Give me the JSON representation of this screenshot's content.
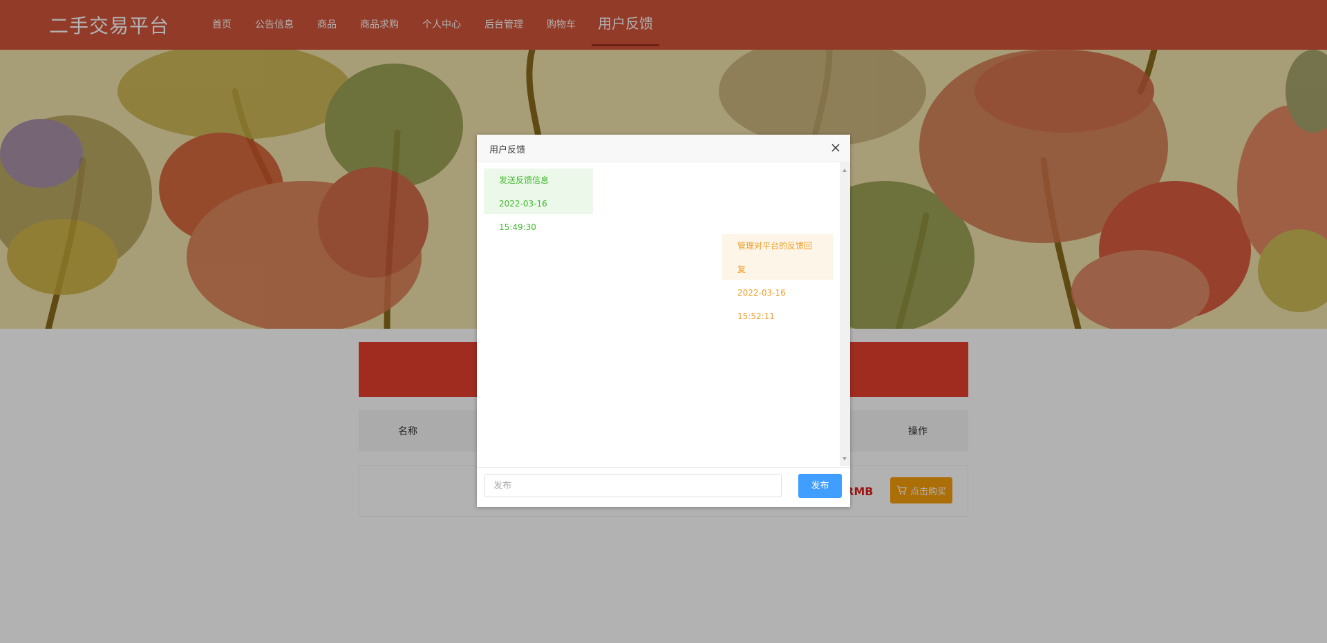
{
  "header": {
    "brand": "二手交易平台",
    "nav": [
      {
        "label": "首页"
      },
      {
        "label": "公告信息"
      },
      {
        "label": "商品"
      },
      {
        "label": "商品求购"
      },
      {
        "label": "个人中心"
      },
      {
        "label": "后台管理"
      },
      {
        "label": "购物车"
      },
      {
        "label": "用户反馈"
      }
    ],
    "active_index": 7
  },
  "table": {
    "col_name": "名称",
    "col_action": "操作",
    "row": {
      "price_unit": "RMB",
      "buy_label": "点击购买"
    }
  },
  "dialog": {
    "title": "用户反馈",
    "messages": [
      {
        "from": "user",
        "text": "发送反馈信息",
        "time": "2022-03-16 15:49:30"
      },
      {
        "from": "admin",
        "text": "管理对平台的反馈回复",
        "time": "2022-03-16 15:52:11"
      }
    ],
    "input_placeholder": "发布",
    "send_label": "发布"
  },
  "colors": {
    "header_bg": "#d2553a",
    "accent_red": "#e63f2e",
    "buy_button": "#f79f0b",
    "send_button": "#409eff",
    "user_bubble_text": "#42b82f",
    "admin_bubble_text": "#ec9e28"
  }
}
